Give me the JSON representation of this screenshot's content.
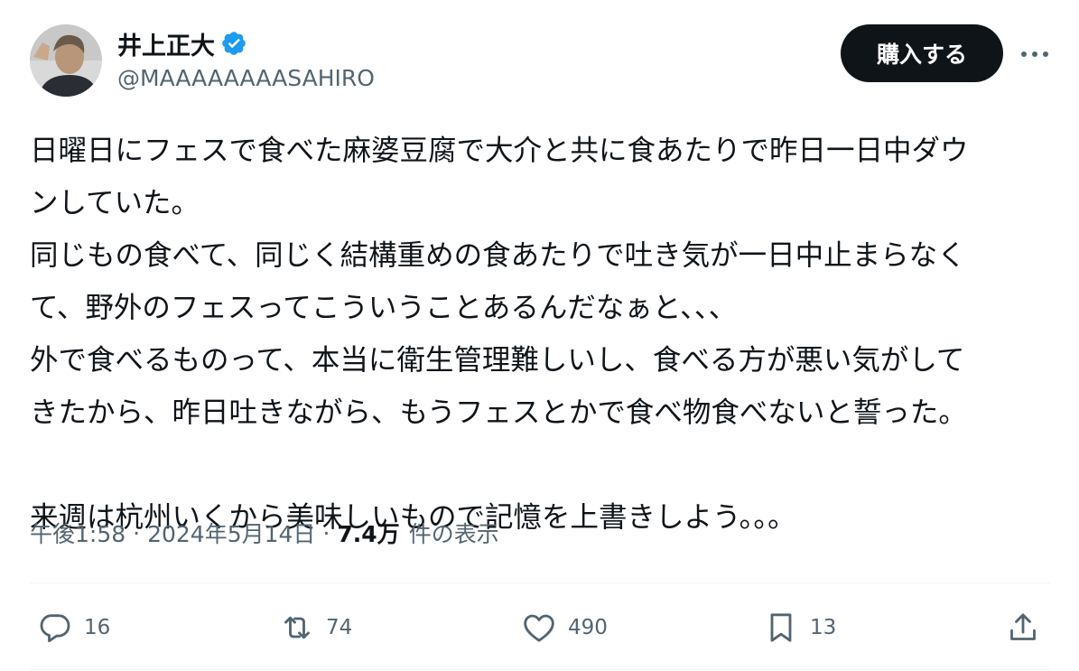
{
  "user": {
    "display_name": "井上正大",
    "handle": "@MAAAAAAAASAHIRO",
    "verified_icon": "verified-badge-icon",
    "verified_color": "#1d9bf0"
  },
  "header": {
    "buy_label": "購入する",
    "more_icon": "more-horizontal-icon"
  },
  "tweet": {
    "lines": [
      "日曜日にフェスで食べた麻婆豆腐で大介と共に食あたりで昨日一日中ダウ",
      "ンしていた。",
      "同じもの食べて、同じく結構重めの食あたりで吐き気が一日中止まらなく",
      "て、野外のフェスってこういうことあるんだなぁと、、、",
      "外で食べるものって、本当に衛生管理難しいし、食べる方が悪い気がして",
      "きたから、昨日吐きながら、もうフェスとかで食べ物食べないと誓った。",
      "",
      "来週は杭州いくから美味しいもので記憶を上書きしよう。。。"
    ]
  },
  "meta": {
    "time": "午後1:58",
    "separator": "·",
    "date": "2024年5月14日",
    "views_count": "7.4万",
    "views_label": "件の表示"
  },
  "actions": {
    "reply": {
      "icon": "reply-icon",
      "count": "16"
    },
    "retweet": {
      "icon": "retweet-icon",
      "count": "74"
    },
    "like": {
      "icon": "heart-icon",
      "count": "490"
    },
    "bookmark": {
      "icon": "bookmark-icon",
      "count": "13"
    },
    "share": {
      "icon": "share-icon"
    }
  },
  "colors": {
    "text_primary": "#0f1419",
    "text_secondary": "#536471",
    "button_bg": "#0f1419"
  }
}
